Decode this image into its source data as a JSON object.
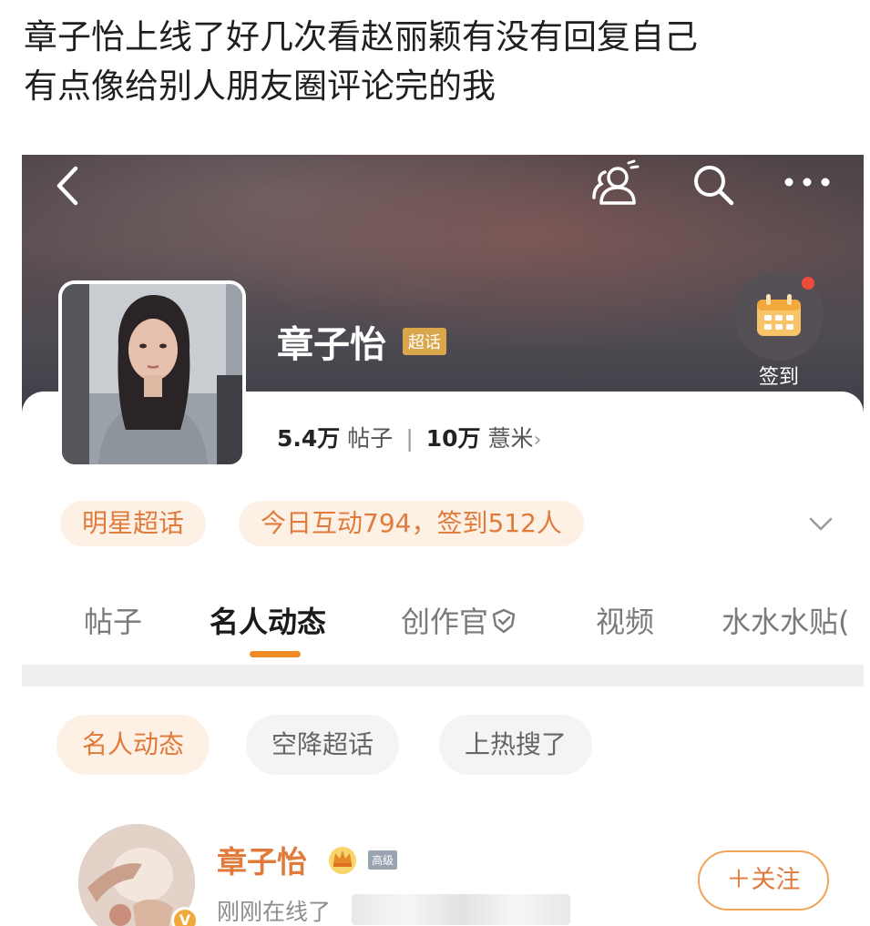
{
  "post": {
    "caption_line1": "章子怡上线了好几次看赵丽颖有没有回复自己",
    "caption_line2": "有点像给别人朋友圈评论完的我"
  },
  "header": {
    "icons": [
      "back-chevron-icon",
      "super-chat-icon",
      "search-icon",
      "more-icon"
    ]
  },
  "profile": {
    "name": "章子怡",
    "badge": "超话",
    "posts_count": "5.4万",
    "posts_label": "帖子",
    "fans_count": "10万",
    "fans_label": "薏米",
    "fans_chevron": "›",
    "checkin_label": "签到"
  },
  "tags": {
    "category": "明星超话",
    "activity": "今日互动794，签到512人"
  },
  "tabs": [
    {
      "label": "帖子",
      "active": false
    },
    {
      "label": "名人动态",
      "active": true
    },
    {
      "label": "创作官",
      "active": false
    },
    {
      "label": "视频",
      "active": false
    },
    {
      "label": "水水水贴(",
      "active": false
    }
  ],
  "chips": [
    {
      "label": "名人动态",
      "active": true
    },
    {
      "label": "空降超话",
      "active": false
    },
    {
      "label": "上热搜了",
      "active": false
    }
  ],
  "feed": {
    "name": "章子怡",
    "status": "刚刚在线了",
    "small_badge": "高级",
    "verify_mark": "V",
    "follow_label": "＋关注"
  },
  "colors": {
    "accent": "#e07b3b",
    "tab_underline": "#f08a24",
    "badge_gold": "#d9a64c",
    "notification_dot": "#f04b3a"
  }
}
